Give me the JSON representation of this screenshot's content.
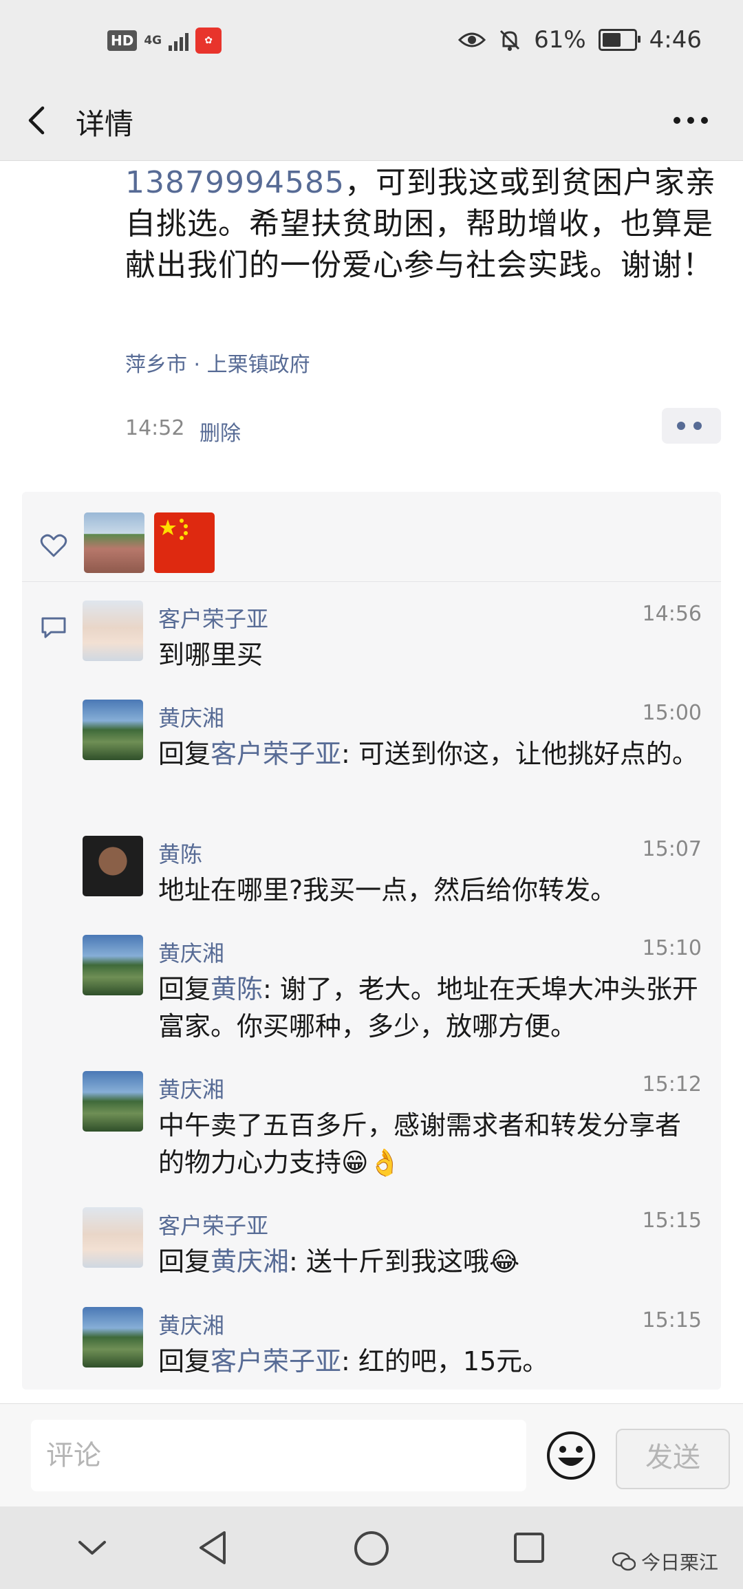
{
  "status_bar": {
    "hd": "HD",
    "network": "4G",
    "battery_percent": "61%",
    "time": "4:46"
  },
  "header": {
    "title": "详情"
  },
  "post": {
    "phone": "13879994585",
    "text_rest": "，可到我这或到贫困户家亲自挑选。希望扶贫助困，帮助增收，也算是献出我们的一份爱心参与社会实践。谢谢！",
    "location": "萍乡市 · 上栗镇政府",
    "time": "14:52",
    "delete_label": "删除"
  },
  "comments": [
    {
      "name": "客户荣子亚",
      "time": "14:56",
      "reply_to": "",
      "text": "到哪里买",
      "emoji": ""
    },
    {
      "name": "黄庆湘",
      "time": "15:00",
      "reply_to": "客户荣子亚",
      "text": ": 可送到你这，让他挑好点的。",
      "emoji": ""
    },
    {
      "name": "黄陈",
      "time": "15:07",
      "reply_to": "",
      "text": "地址在哪里?我买一点，然后给你转发。",
      "emoji": ""
    },
    {
      "name": "黄庆湘",
      "time": "15:10",
      "reply_to": "黄陈",
      "text": ": 谢了，老大。地址在夭埠大冲头张开富家。你买哪种，多少，放哪方便。",
      "emoji": ""
    },
    {
      "name": "黄庆湘",
      "time": "15:12",
      "reply_to": "",
      "text": "中午卖了五百多斤，感谢需求者和转发分享者的物力心力支持",
      "emoji": "😁👌"
    },
    {
      "name": "客户荣子亚",
      "time": "15:15",
      "reply_to": "黄庆湘",
      "text": ": 送十斤到我这哦",
      "emoji": "😂"
    },
    {
      "name": "黄庆湘",
      "time": "15:15",
      "reply_to": "客户荣子亚",
      "text": ": 红的吧，15元。",
      "emoji": ""
    }
  ],
  "reply_prefix": "回复",
  "input": {
    "placeholder": "评论",
    "send_label": "发送"
  },
  "watermark": "今日栗江",
  "icons": {
    "back": "back-arrow-icon",
    "more": "more-dots-icon",
    "heart": "heart-icon",
    "comment": "comment-bubble-icon",
    "emoji": "emoji-smile-icon",
    "nav_down": "chevron-down-icon",
    "nav_back": "triangle-back-icon",
    "nav_home": "circle-home-icon",
    "nav_recent": "square-recent-icon"
  },
  "colors": {
    "link": "#576b95",
    "header_bg": "#ededed",
    "box_bg": "#f6f6f7"
  }
}
